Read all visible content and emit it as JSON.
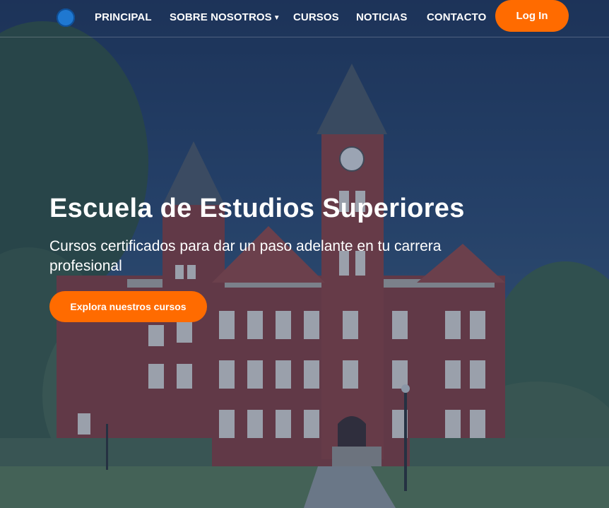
{
  "nav": {
    "items": [
      {
        "label": "PRINCIPAL"
      },
      {
        "label": "SOBRE NOSOTROS"
      },
      {
        "label": "CURSOS"
      },
      {
        "label": "NOTICIAS"
      },
      {
        "label": "CONTACTO"
      }
    ],
    "login_label": "Log In"
  },
  "hero": {
    "title": "Escuela de Estudios Superiores",
    "subtitle": "Cursos certificados para dar un paso adelante en tu carrera profesional",
    "cta_label": "Explora nuestros cursos"
  },
  "colors": {
    "accent": "#ff6b00",
    "overlay": "#1c345c",
    "logo": "#1f78d1"
  },
  "icons": {
    "logo": "graduation-cap-logo-icon",
    "dropdown": "caret-down-icon"
  }
}
